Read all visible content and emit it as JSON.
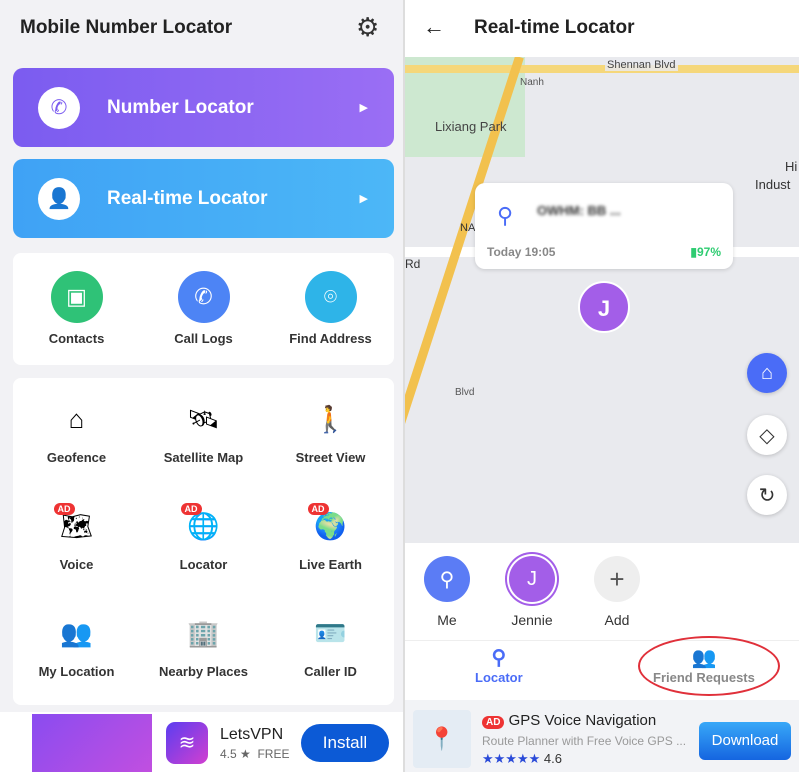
{
  "left": {
    "title": "Mobile Number Locator",
    "big_cards": [
      {
        "label": "Number Locator",
        "icon": "phone-pin-icon"
      },
      {
        "label": "Real-time Locator",
        "icon": "person-pin-icon"
      }
    ],
    "tools": [
      {
        "label": "Contacts",
        "color": "#2fc277"
      },
      {
        "label": "Call Logs",
        "color": "#4d84f5"
      },
      {
        "label": "Find Address",
        "color": "#2eb4e8"
      }
    ],
    "features": [
      {
        "label": "Geofence",
        "icon": "house-pin-icon",
        "ad": false
      },
      {
        "label": "Satellite Map",
        "icon": "satellite-icon",
        "ad": false
      },
      {
        "label": "Street View",
        "icon": "street-person-icon",
        "ad": false
      },
      {
        "label": "Voice",
        "icon": "route-map-icon",
        "ad": true
      },
      {
        "label": "Locator",
        "icon": "globe-pin-icon",
        "ad": true
      },
      {
        "label": "Live Earth",
        "icon": "earth-icon",
        "ad": true
      },
      {
        "label": "My Location",
        "icon": "people-pin-icon",
        "ad": false
      },
      {
        "label": "Nearby Places",
        "icon": "building-icon",
        "ad": false
      },
      {
        "label": "Caller ID",
        "icon": "id-card-icon",
        "ad": false
      }
    ],
    "ad_label": "AD",
    "ad": {
      "app": "LetsVPN",
      "rating": "4.5 ★",
      "price": "FREE",
      "button": "Install"
    }
  },
  "right": {
    "title": "Real-time Locator",
    "map_labels": [
      "Lixiang Park",
      "Shennan Blvd",
      "Rd",
      "NA",
      "Hi",
      "Indust",
      "Nanh",
      "Blvd"
    ],
    "popup": {
      "address": "OWHM: BB ...",
      "time": "Today 19:05",
      "battery": "97%"
    },
    "marker_initial": "J",
    "people": [
      {
        "name": "Me",
        "initial": ""
      },
      {
        "name": "Jennie",
        "initial": "J"
      },
      {
        "name": "Add",
        "initial": "+"
      }
    ],
    "tabs": [
      {
        "label": "Locator",
        "active": true
      },
      {
        "label": "Friend Requests",
        "active": false
      }
    ],
    "ad": {
      "badge": "AD",
      "title": "GPS Voice Navigation",
      "subtitle": "Route Planner with Free Voice GPS ...",
      "rating": "4.6",
      "stars": 4.5,
      "button": "Download"
    }
  },
  "colors": {
    "purple": "#7b5cf0",
    "blue": "#3fa2f5",
    "accent": "#4a6cf7",
    "green": "#2ecc71"
  }
}
